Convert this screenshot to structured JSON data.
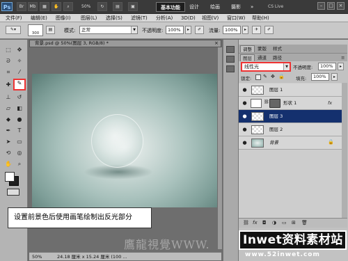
{
  "appbar": {
    "logo": "Ps",
    "zoom": "50%",
    "workspaces": [
      "基本功能",
      "设计",
      "绘画",
      "摄影"
    ],
    "more": "»",
    "cslive": "CS Live"
  },
  "menu": [
    "文件(F)",
    "编辑(E)",
    "图像(I)",
    "图层(L)",
    "选择(S)",
    "滤镜(T)",
    "分析(A)",
    "3D(D)",
    "视图(V)",
    "窗口(W)",
    "帮助(H)"
  ],
  "options": {
    "brush_size": "300",
    "mode_label": "模式:",
    "mode_value": "正常",
    "opacity_label": "不透明度:",
    "opacity_value": "100%",
    "flow_label": "流量:",
    "flow_value": "100%"
  },
  "document": {
    "tab_title": "背景.psd @ 50%(图层 3, RGB/8) *",
    "status_zoom": "50%",
    "status_size": "24.18 厘米 x 15.24 厘米 (100 ..."
  },
  "caption": "设置前景色后使用画笔绘制出反光部分",
  "panel": {
    "tabs_top": [
      "调整",
      "蒙版",
      "样式"
    ],
    "tabs_layers": [
      "图层",
      "通道",
      "路径"
    ],
    "blend_mode": "线性光",
    "opacity_label": "不透明度:",
    "opacity_value": "100%",
    "lock_label": "锁定:",
    "fill_label": "填充:",
    "fill_value": "100%",
    "layers": [
      {
        "name": "图层 1",
        "selected": false
      },
      {
        "name": "形状 1",
        "selected": false,
        "fx": "fx"
      },
      {
        "name": "图层 3",
        "selected": true
      },
      {
        "name": "图层 2",
        "selected": false
      },
      {
        "name": "背景",
        "selected": false
      }
    ]
  },
  "watermark": {
    "text": "鷹龍視覺WWW.",
    "logo": "Inwet资料素材站",
    "url": "www.52inwet.com"
  },
  "colors": {
    "accent_red": "#e33333",
    "selected_layer": "#14306e"
  }
}
